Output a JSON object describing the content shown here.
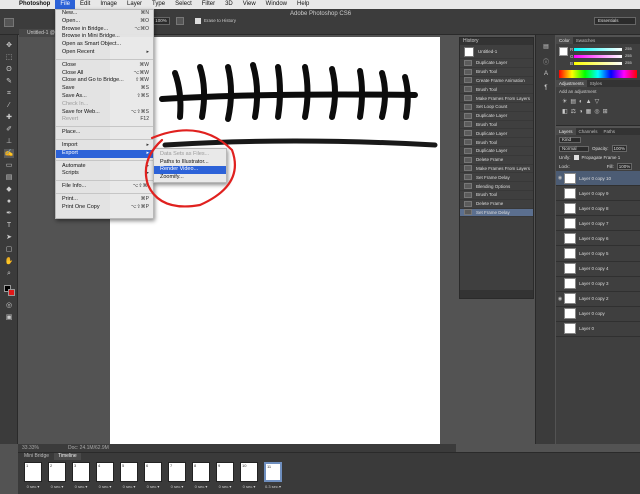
{
  "menubar": {
    "app": "Photoshop",
    "items": [
      "File",
      "Edit",
      "Image",
      "Layer",
      "Type",
      "Select",
      "Filter",
      "3D",
      "View",
      "Window",
      "Help"
    ],
    "active": "File"
  },
  "window": {
    "title": "Adobe Photoshop CS6"
  },
  "options": {
    "zoom_value": "100%",
    "erase_history": "Erase to History",
    "workspace": "Essentials"
  },
  "document": {
    "tab": "Untitled-1 @"
  },
  "file_menu": {
    "items": [
      {
        "label": "New...",
        "shortcut": "⌘N"
      },
      {
        "label": "Open...",
        "shortcut": "⌘O"
      },
      {
        "label": "Browse in Bridge...",
        "shortcut": "⌥⌘O"
      },
      {
        "label": "Browse in Mini Bridge...",
        "shortcut": ""
      },
      {
        "label": "Open as Smart Object...",
        "shortcut": ""
      },
      {
        "label": "Open Recent",
        "shortcut": "▸"
      },
      {
        "label": "Close",
        "shortcut": "⌘W"
      },
      {
        "label": "Close All",
        "shortcut": "⌥⌘W"
      },
      {
        "label": "Close and Go to Bridge...",
        "shortcut": "⇧⌘W"
      },
      {
        "label": "Save",
        "shortcut": "⌘S"
      },
      {
        "label": "Save As...",
        "shortcut": "⇧⌘S"
      },
      {
        "label": "Check In...",
        "shortcut": ""
      },
      {
        "label": "Save for Web...",
        "shortcut": "⌥⇧⌘S"
      },
      {
        "label": "Revert",
        "shortcut": "F12"
      },
      {
        "label": "Place...",
        "shortcut": ""
      },
      {
        "label": "Import",
        "shortcut": "▸"
      },
      {
        "label": "Export",
        "shortcut": "▸"
      },
      {
        "label": "Automate",
        "shortcut": "▸"
      },
      {
        "label": "Scripts",
        "shortcut": "▸"
      },
      {
        "label": "File Info...",
        "shortcut": "⌥⇧⌘I"
      },
      {
        "label": "Print...",
        "shortcut": "⌘P"
      },
      {
        "label": "Print One Copy",
        "shortcut": "⌥⇧⌘P"
      }
    ]
  },
  "export_submenu": {
    "items": [
      "Data Sets as Files...",
      "Paths to Illustrator...",
      "Render Video...",
      "Zoomify..."
    ]
  },
  "history": {
    "title": "History",
    "snapshot": "Untitled-1",
    "items": [
      "Duplicate Layer",
      "Brush Tool",
      "Create Frame Animation",
      "Brush Tool",
      "Make Frames From Layers",
      "Set Loop Count",
      "Duplicate Layer",
      "Brush Tool",
      "Duplicate Layer",
      "Brush Tool",
      "Duplicate Layer",
      "Delete Frame",
      "Make Frames From Layers",
      "Set Frame Delay",
      "Blending Options",
      "Brush Tool",
      "Delete Frame",
      "Set Frame Delay"
    ]
  },
  "color_panel": {
    "tabs": [
      "Color",
      "Swatches"
    ],
    "channels": [
      "R",
      "G",
      "B"
    ],
    "values": [
      "255",
      "255",
      "255"
    ]
  },
  "adjust_panel": {
    "tabs": [
      "Adjustments",
      "Styles"
    ],
    "hint": "Add an adjustment"
  },
  "layers_panel": {
    "tabs": [
      "Layers",
      "Channels",
      "Paths"
    ],
    "kind": "Kind",
    "blend_mode": "Normal",
    "opacity_label": "Opacity:",
    "opacity": "100%",
    "unify": "Unify:",
    "propagate": "Propagate Frame 1",
    "lock": "Lock:",
    "fill_label": "Fill:",
    "fill": "100%",
    "layers": [
      "Layer 0 copy 10",
      "Layer 0 copy 9",
      "Layer 0 copy 8",
      "Layer 0 copy 7",
      "Layer 0 copy 6",
      "Layer 0 copy 5",
      "Layer 0 copy 4",
      "Layer 0 copy 3",
      "Layer 0 copy 2",
      "Layer 0 copy",
      "Layer 0"
    ]
  },
  "status": {
    "zoom": "33.33%",
    "doc": "Doc: 24.1M/62.9M"
  },
  "timeline": {
    "tabs": [
      "Mini Bridge",
      "Timeline"
    ],
    "frames": [
      {
        "num": "1",
        "delay": "0 sec.▾"
      },
      {
        "num": "2",
        "delay": "0 sec.▾"
      },
      {
        "num": "3",
        "delay": "0 sec.▾"
      },
      {
        "num": "4",
        "delay": "0 sec.▾"
      },
      {
        "num": "5",
        "delay": "0 sec.▾"
      },
      {
        "num": "6",
        "delay": "0 sec.▾"
      },
      {
        "num": "7",
        "delay": "0 sec.▾"
      },
      {
        "num": "8",
        "delay": "0 sec.▾"
      },
      {
        "num": "9",
        "delay": "0 sec.▾"
      },
      {
        "num": "10",
        "delay": "0 sec.▾"
      },
      {
        "num": "11",
        "delay": "0.3 sec.▾"
      }
    ]
  },
  "colors": {
    "accent": "#2c62d8",
    "annotation": "#e0211f",
    "selection": "#5b6f8f"
  }
}
